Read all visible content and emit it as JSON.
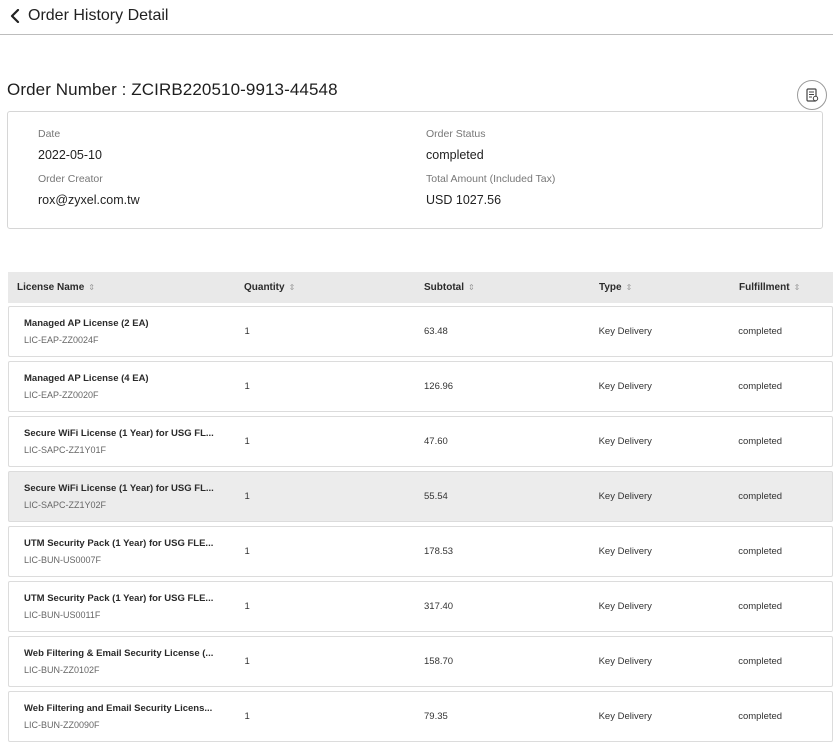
{
  "header": {
    "back_label": "Order History Detail"
  },
  "order": {
    "title": "Order Number : ZCIRB220510-9913-44548"
  },
  "info": {
    "date_label": "Date",
    "date_value": "2022-05-10",
    "creator_label": "Order Creator",
    "creator_value": "rox@zyxel.com.tw",
    "status_label": "Order Status",
    "status_value": "completed",
    "total_label": "Total Amount (Included Tax)",
    "total_value": "USD 1027.56"
  },
  "table": {
    "columns": [
      "License Name",
      "Quantity",
      "Subtotal",
      "Type",
      "Fulfillment"
    ],
    "rows": [
      {
        "name": "Managed AP License (2 EA)",
        "code": "LIC-EAP-ZZ0024F",
        "qty": "1",
        "subtotal": "63.48",
        "type": "Key Delivery",
        "fulfillment": "completed"
      },
      {
        "name": "Managed AP License (4 EA)",
        "code": "LIC-EAP-ZZ0020F",
        "qty": "1",
        "subtotal": "126.96",
        "type": "Key Delivery",
        "fulfillment": "completed"
      },
      {
        "name": "Secure WiFi License (1 Year) for USG FL...",
        "code": "LIC-SAPC-ZZ1Y01F",
        "qty": "1",
        "subtotal": "47.60",
        "type": "Key Delivery",
        "fulfillment": "completed"
      },
      {
        "name": "Secure WiFi License (1 Year) for USG FL...",
        "code": "LIC-SAPC-ZZ1Y02F",
        "qty": "1",
        "subtotal": "55.54",
        "type": "Key Delivery",
        "fulfillment": "completed"
      },
      {
        "name": "UTM Security Pack (1 Year) for USG FLE...",
        "code": "LIC-BUN-US0007F",
        "qty": "1",
        "subtotal": "178.53",
        "type": "Key Delivery",
        "fulfillment": "completed"
      },
      {
        "name": "UTM Security Pack (1 Year) for USG FLE...",
        "code": "LIC-BUN-US0011F",
        "qty": "1",
        "subtotal": "317.40",
        "type": "Key Delivery",
        "fulfillment": "completed"
      },
      {
        "name": "Web Filtering & Email Security License (...",
        "code": "LIC-BUN-ZZ0102F",
        "qty": "1",
        "subtotal": "158.70",
        "type": "Key Delivery",
        "fulfillment": "completed"
      },
      {
        "name": "Web Filtering and Email Security Licens...",
        "code": "LIC-BUN-ZZ0090F",
        "qty": "1",
        "subtotal": "79.35",
        "type": "Key Delivery",
        "fulfillment": "completed"
      }
    ]
  },
  "icons": {
    "back": "chevron-left-icon",
    "receipt": "receipt-icon",
    "sort": "sort-icon"
  },
  "colors": {
    "header_bg": "#e9e9e9",
    "highlight_row": "#ececec",
    "border": "#dcdcdc"
  }
}
